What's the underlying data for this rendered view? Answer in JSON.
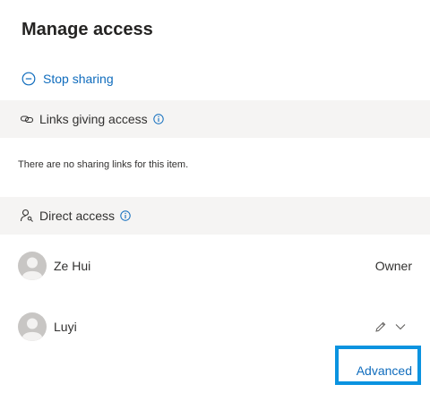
{
  "panel": {
    "title": "Manage access"
  },
  "stop_sharing": {
    "label": "Stop sharing",
    "icon": "minus-circle-icon"
  },
  "links_section": {
    "title": "Links giving access",
    "icon": "link-icon",
    "info_icon": "info-icon",
    "empty_message": "There are no sharing links for this item."
  },
  "direct_section": {
    "title": "Direct access",
    "icon": "person-key-icon",
    "info_icon": "info-icon"
  },
  "people": [
    {
      "name": "Ze Hui",
      "role": "Owner"
    },
    {
      "name": "Luyi",
      "permission_icon": "pencil-icon",
      "dropdown_icon": "chevron-down-icon"
    }
  ],
  "advanced": {
    "label": "Advanced"
  },
  "colors": {
    "accent": "#0f6cbd",
    "section_bg": "#f5f4f3",
    "highlight": "#0b93e0"
  }
}
